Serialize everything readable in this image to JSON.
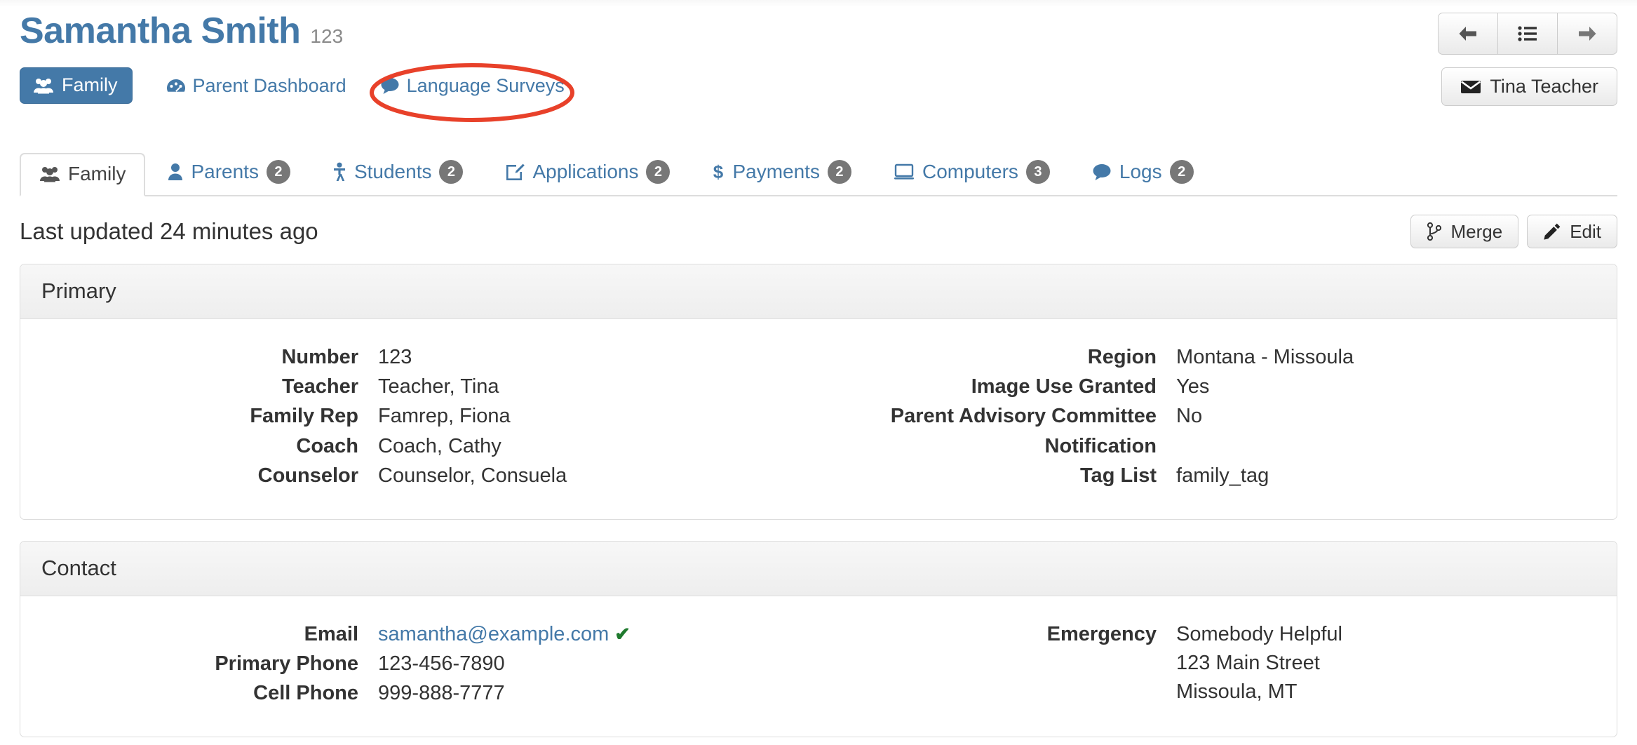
{
  "header": {
    "title": "Samantha Smith",
    "record_id": "123",
    "quick_links": [
      {
        "label": "Family",
        "icon": "users-icon",
        "style": "primary"
      },
      {
        "label": "Parent Dashboard",
        "icon": "dashboard-icon",
        "style": "link"
      },
      {
        "label": "Language Surveys",
        "icon": "comment-icon",
        "style": "link",
        "annotated": true
      }
    ],
    "nav_buttons": [
      {
        "name": "previous-record-button",
        "icon": "arrow-left-icon"
      },
      {
        "name": "record-list-button",
        "icon": "list-icon"
      },
      {
        "name": "next-record-button",
        "icon": "arrow-right-icon"
      }
    ],
    "user_button": {
      "label": "Tina Teacher",
      "icon": "envelope-icon"
    },
    "annotation_color": "#e8412a"
  },
  "tabs": [
    {
      "label": "Family",
      "icon": "users-icon",
      "badge": "",
      "active": true
    },
    {
      "label": "Parents",
      "icon": "user-icon",
      "badge": "2",
      "active": false
    },
    {
      "label": "Students",
      "icon": "child-icon",
      "badge": "2",
      "active": false
    },
    {
      "label": "Applications",
      "icon": "edit-document-icon",
      "badge": "2",
      "active": false
    },
    {
      "label": "Payments",
      "icon": "dollar-icon",
      "badge": "2",
      "active": false
    },
    {
      "label": "Computers",
      "icon": "desktop-icon",
      "badge": "3",
      "active": false
    },
    {
      "label": "Logs",
      "icon": "comment-icon",
      "badge": "2",
      "active": false
    }
  ],
  "meta": {
    "last_updated": "Last updated 24 minutes ago",
    "merge_label": "Merge",
    "edit_label": "Edit"
  },
  "panels": [
    {
      "title": "Primary",
      "left": [
        {
          "label": "Number",
          "value": "123"
        },
        {
          "label": "Teacher",
          "value": "Teacher, Tina"
        },
        {
          "label": "Family Rep",
          "value": "Famrep, Fiona"
        },
        {
          "label": "Coach",
          "value": "Coach, Cathy"
        },
        {
          "label": "Counselor",
          "value": "Counselor, Consuela"
        }
      ],
      "right": [
        {
          "label": "Region",
          "value": "Montana - Missoula"
        },
        {
          "label": "Image Use Granted",
          "value": "Yes"
        },
        {
          "label": "Parent Advisory Committee",
          "value": "No"
        },
        {
          "label": "Notification",
          "value": ""
        },
        {
          "label": "Tag List",
          "value": "family_tag"
        }
      ]
    },
    {
      "title": "Contact",
      "left": [
        {
          "label": "Email",
          "value": "samantha@example.com",
          "link": true,
          "verified": true
        },
        {
          "label": "Primary Phone",
          "value": "123-456-7890"
        },
        {
          "label": "Cell Phone",
          "value": "999-888-7777"
        }
      ],
      "right": [
        {
          "label": "Emergency",
          "value": "Somebody Helpful\n123 Main Street\nMissoula, MT"
        }
      ]
    }
  ],
  "colors": {
    "brand_blue": "#4479a8",
    "annotation_red": "#e8412a",
    "badge_gray": "#777777",
    "verified_green": "#1f7a2e"
  }
}
